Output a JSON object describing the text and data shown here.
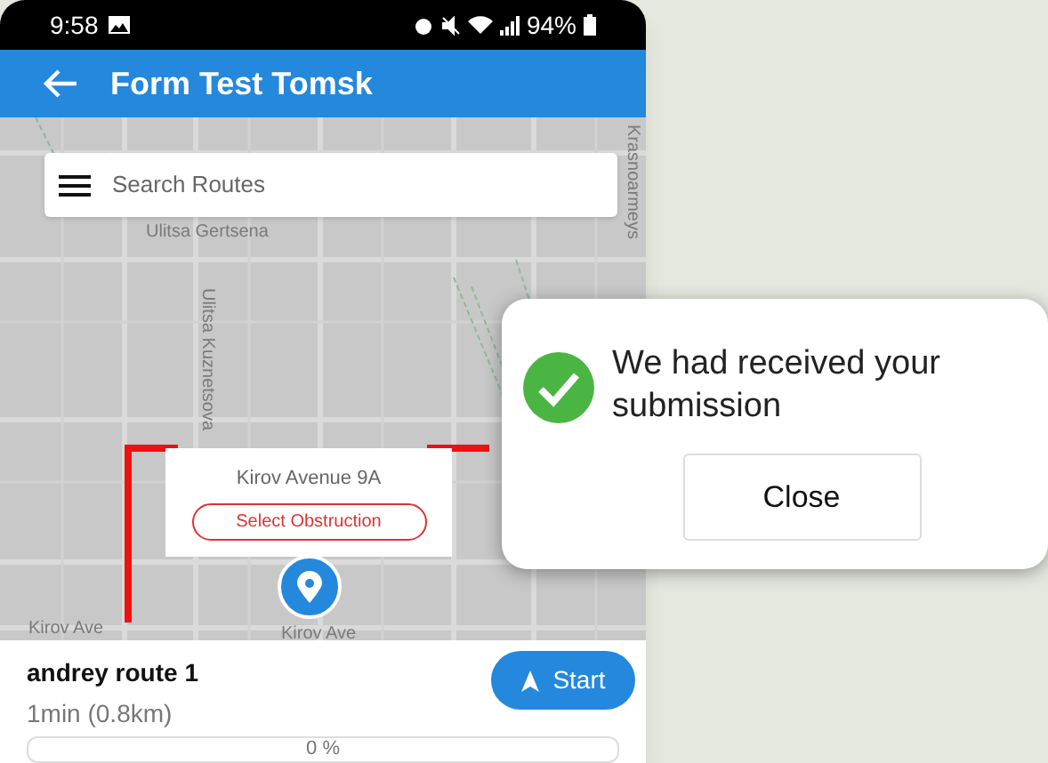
{
  "status_bar": {
    "time": "9:58",
    "battery": "94%"
  },
  "app_bar": {
    "title": "Form Test Tomsk"
  },
  "search": {
    "placeholder": "Search Routes"
  },
  "map": {
    "labels": [
      {
        "text": "Ulitsa Gertsena",
        "kind": "horizontal"
      },
      {
        "text": "Ulitsa Kuznetsova",
        "kind": "vertical"
      },
      {
        "text": "Krasnoarmeys",
        "kind": "vertical"
      },
      {
        "text": "Kirov Ave",
        "kind": "horizontal"
      },
      {
        "text": "Kirov Ave",
        "kind": "horizontal"
      }
    ],
    "popup": {
      "address": "Kirov Avenue 9A",
      "button": "Select Obstruction"
    }
  },
  "route": {
    "name": "andrey route 1",
    "duration": "1min (0.8km)",
    "start_button": "Start",
    "progress": {
      "level": 0,
      "reading": "0 %"
    }
  },
  "dialog": {
    "message": "We had received your submission",
    "button": "Close"
  }
}
